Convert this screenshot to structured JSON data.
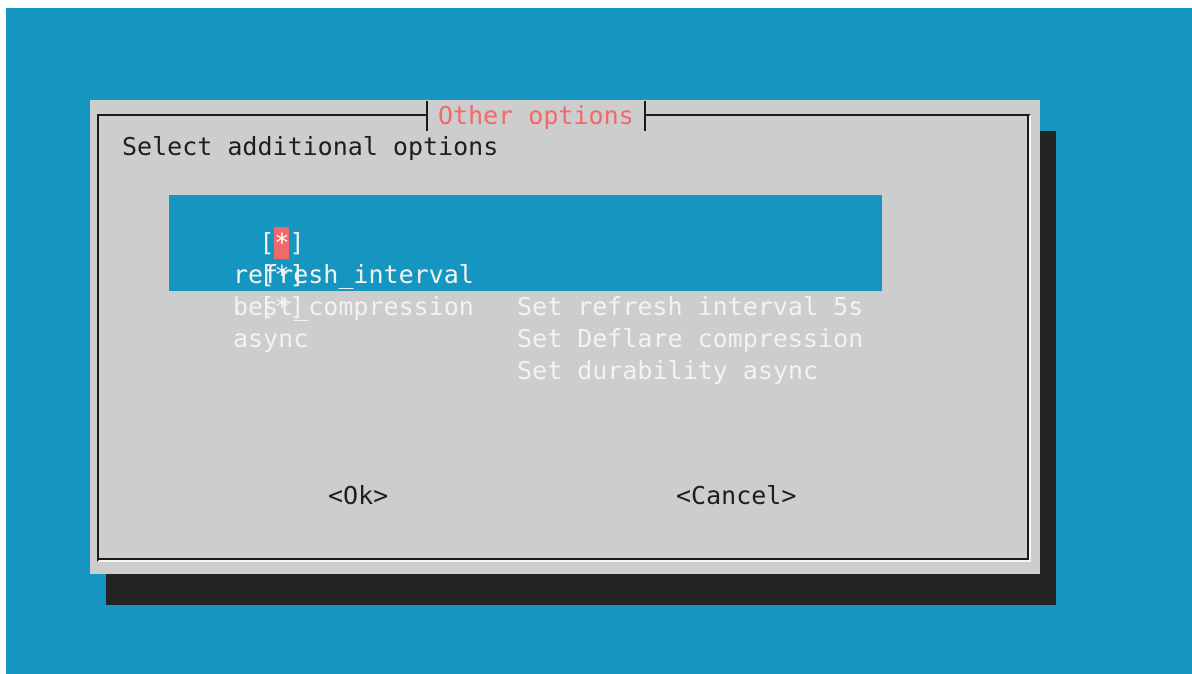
{
  "dialog": {
    "title": "Other options",
    "prompt": "Select additional options",
    "items": [
      {
        "mark": "*",
        "tag": "refresh_interval",
        "description": "Set refresh interval 5s",
        "checked": true,
        "focused": true
      },
      {
        "mark": "*",
        "tag": "best_compression",
        "description": "Set Deflare compression",
        "checked": true,
        "focused": false
      },
      {
        "mark": "*",
        "tag": "async",
        "description": "Set durability async",
        "checked": true,
        "focused": false
      }
    ],
    "buttons": {
      "ok": "<Ok>",
      "cancel": "<Cancel>"
    }
  },
  "colors": {
    "background": "#1596c0",
    "dialog": "#cdcdcd",
    "shadow": "#232323",
    "title": "#f06a6a",
    "highlight": "#1596c0",
    "focus": "#f06a6a"
  }
}
